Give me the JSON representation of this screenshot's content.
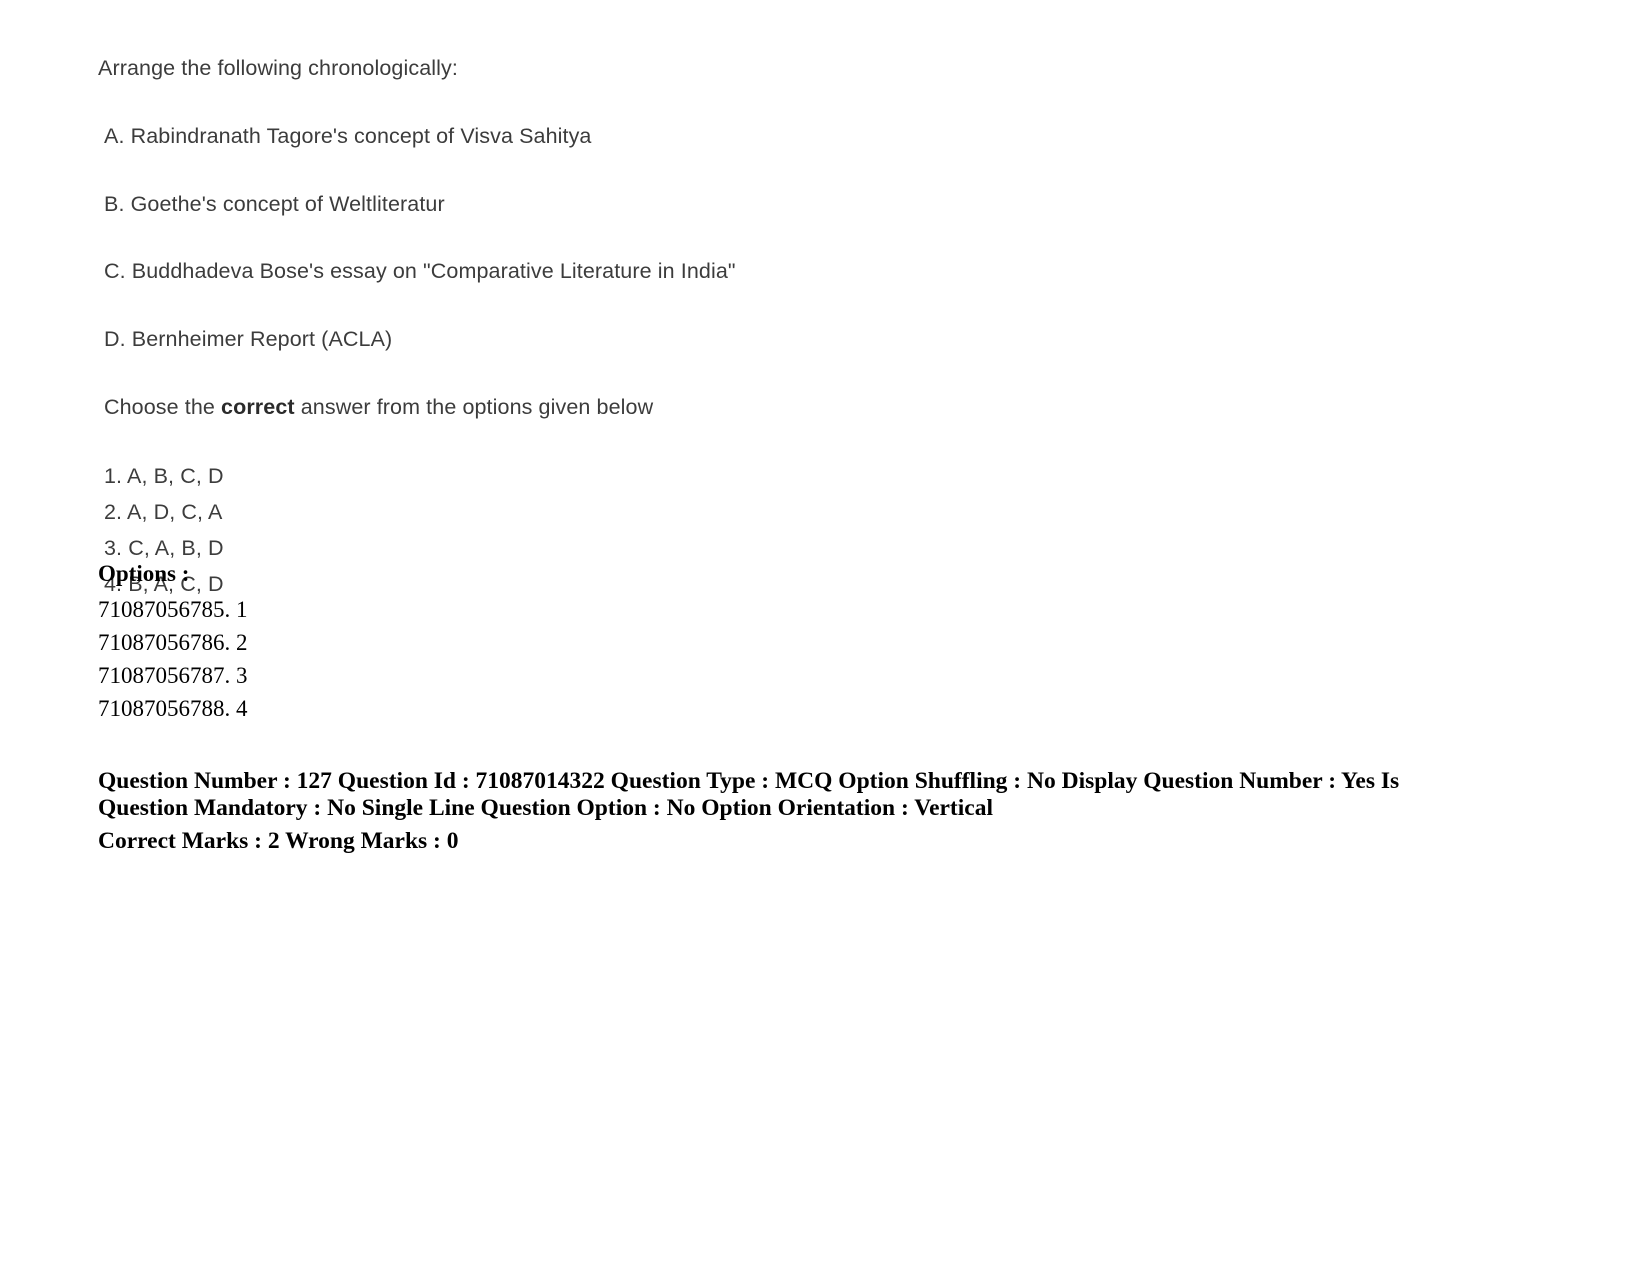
{
  "question": {
    "stem": "Arrange the following chronologically:",
    "statements": [
      "A. Rabindranath Tagore's concept of Visva Sahitya",
      "B. Goethe's concept of Weltliteratur",
      "C. Buddhadeva Bose's essay on \"Comparative Literature in India\"",
      "D. Bernheimer Report (ACLA)"
    ],
    "choose_prefix": "Choose the ",
    "choose_bold": "correct",
    "choose_suffix": " answer from the options given below",
    "answers": [
      "1. A, B, C, D",
      "2. A, D, C, A",
      "3. C, A, B, D",
      "4. B, A, C, D"
    ]
  },
  "options_section": {
    "heading": "Options :",
    "option_ids": [
      "71087056785. 1",
      "71087056786. 2",
      "71087056787. 3",
      "71087056788. 4"
    ]
  },
  "metadata": {
    "line1": "Question Number : 127 Question Id : 71087014322 Question Type : MCQ Option Shuffling : No Display Question Number : Yes Is Question Mandatory : No Single Line Question Option : No Option Orientation : Vertical",
    "line2": "Correct Marks : 2 Wrong Marks : 0",
    "question_number": "127",
    "question_id": "71087014322",
    "question_type": "MCQ",
    "option_shuffling": "No",
    "display_question_number": "Yes",
    "is_question_mandatory": "No",
    "single_line_question_option": "No",
    "option_orientation": "Vertical",
    "correct_marks": "2",
    "wrong_marks": "0"
  }
}
